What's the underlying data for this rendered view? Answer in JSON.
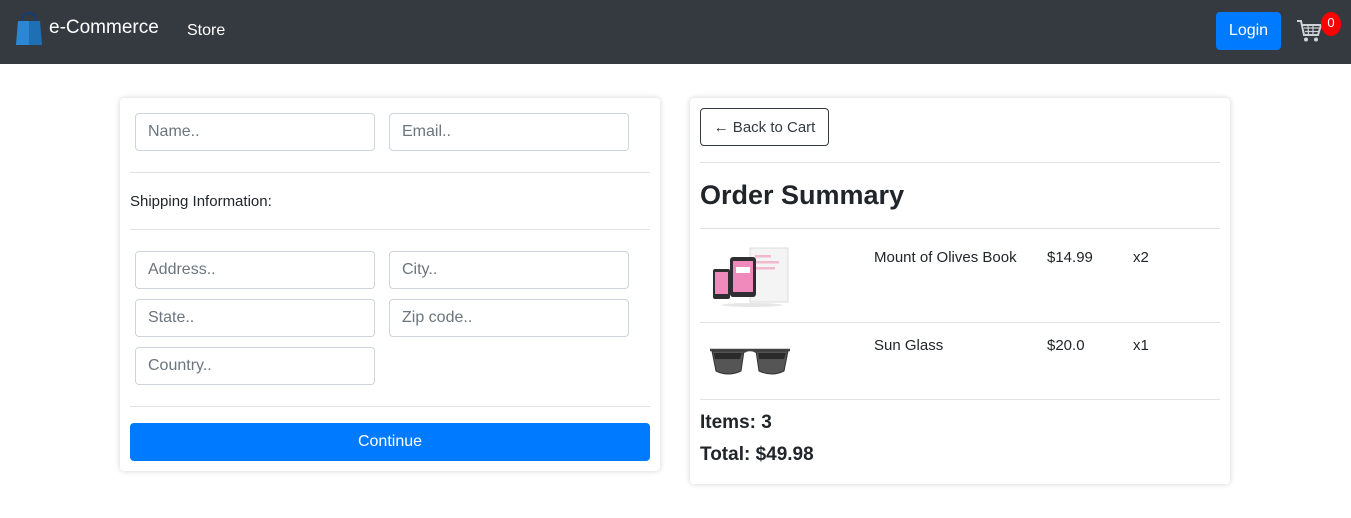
{
  "navbar": {
    "brand": "e-Commerce",
    "store_link": "Store",
    "login_label": "Login",
    "cart_count": "0"
  },
  "form": {
    "name_placeholder": "Name..",
    "email_placeholder": "Email..",
    "shipping_label": "Shipping Information:",
    "address_placeholder": "Address..",
    "city_placeholder": "City..",
    "state_placeholder": "State..",
    "zip_placeholder": "Zip code..",
    "country_placeholder": "Country..",
    "continue_label": "Continue"
  },
  "summary": {
    "back_label": "← Back to Cart",
    "title": "Order Summary",
    "items": [
      {
        "name": "Mount of Olives Book",
        "price": "$14.99",
        "qty": "x2",
        "icon": "book-tablet-image"
      },
      {
        "name": "Sun Glass",
        "price": "$20.0",
        "qty": "x1",
        "icon": "sunglasses-image"
      }
    ],
    "items_line": "Items: 3",
    "total_line": "Total: $49.98"
  },
  "colors": {
    "navbar": "#343a40",
    "primary": "#007bff",
    "badge": "#ff0000"
  }
}
